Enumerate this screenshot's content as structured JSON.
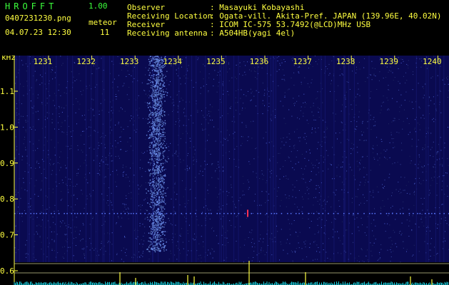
{
  "header": {
    "app_name": "HROFFT",
    "version": "1.00",
    "filename": "0407231230.png",
    "datetime": "04.07.23 12:30",
    "meteor_label": "meteor",
    "meteor_count": "11",
    "info": [
      {
        "label": "Observer",
        "value": ": Masayuki Kobayashi"
      },
      {
        "label": "Receiving Location",
        "value": ": Ogata-vill. Akita-Pref. JAPAN (139.96E, 40.02N)"
      },
      {
        "label": "Receiver",
        "value": ": ICOM IC-575 53.7492(@LCD)MHz USB"
      },
      {
        "label": "Receiving antenna",
        "value": ": A504HB(yagi 4el)"
      }
    ]
  },
  "chart_data": {
    "type": "heatmap",
    "ylabel": "kHz",
    "x_ticks": [
      "1231",
      "1232",
      "1233",
      "1234",
      "1235",
      "1236",
      "1237",
      "1238",
      "1239",
      "1240"
    ],
    "y_ticks": [
      "1.1",
      "1.0",
      "0.9",
      "0.8",
      "0.7",
      "0.6"
    ],
    "y_tick_values": [
      1.1,
      1.0,
      0.9,
      0.8,
      0.7,
      0.6
    ],
    "background_color": "#0a0a50",
    "signal_color": "#4060ff",
    "axis_color": "#ffff40",
    "meteor_echo_minutes": [
      1233.5
    ],
    "carrier_frequency_khz": 0.76
  }
}
